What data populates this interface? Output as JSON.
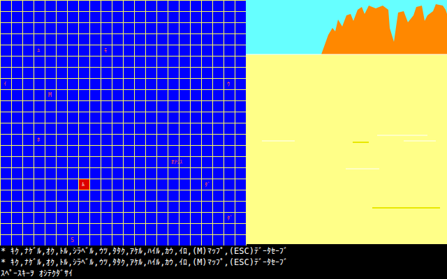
{
  "map": {
    "markers": [
      {
        "label": "ﾕ",
        "col": 3,
        "row": 4,
        "player": false
      },
      {
        "label": "ﾓ",
        "col": 9,
        "row": 4,
        "player": false
      },
      {
        "label": "ｲ",
        "col": 0,
        "row": 7,
        "player": false
      },
      {
        "label": "ｳ",
        "col": 20,
        "row": 7,
        "player": false
      },
      {
        "label": "M",
        "col": 4,
        "row": 8,
        "player": false
      },
      {
        "label": "ﾎ",
        "col": 3,
        "row": 12,
        "player": false
      },
      {
        "label": "ｵｱｼｽ",
        "col": 15,
        "row": 14,
        "player": false
      },
      {
        "label": "ﾀﾞ",
        "col": 18,
        "row": 16,
        "player": false
      },
      {
        "label": "ﾑ",
        "col": 7,
        "row": 16,
        "player": true
      },
      {
        "label": "ﾀﾞ",
        "col": 20,
        "row": 19,
        "player": false
      },
      {
        "label": "S",
        "col": 6,
        "row": 21,
        "player": false
      }
    ]
  },
  "messages": [
    "* ｷｸ,ﾅｹﾞﾙ,ｵｸ,ﾄﾙ,ｼﾗﾍﾞﾙ,ｳﾂ,ﾀﾀｸ,ｱｹﾙ,ﾊｲﾙ,ｶｳ,ｲﾛ,(M)ﾏｯﾌﾟ,(ESC)ﾃﾞｰﾀｾｰﾌﾞ",
    "* ｷｸ,ﾅｹﾞﾙ,ｵｸ,ﾄﾙ,ｼﾗﾍﾞﾙ,ｳﾂ,ﾀﾀｸ,ｱｹﾙ,ﾊｲﾙ,ｶｳ,ｲﾛ,(M)ﾏｯﾌﾟ,(ESC)ﾃﾞｰﾀｾｰﾌﾞ",
    "ｽﾍﾟｰｽｷｰｦ ｵｼﾃｸﾀﾞｻｲ"
  ]
}
